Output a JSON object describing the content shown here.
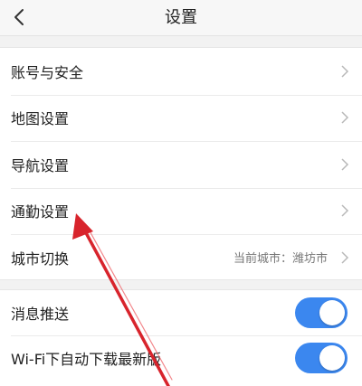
{
  "header": {
    "title": "设置"
  },
  "settings_group": [
    {
      "name": "settings-account-security",
      "label": "账号与安全"
    },
    {
      "name": "settings-map",
      "label": "地图设置"
    },
    {
      "name": "settings-navigation",
      "label": "导航设置"
    },
    {
      "name": "settings-commute",
      "label": "通勤设置"
    },
    {
      "name": "settings-city",
      "label": "城市切换",
      "value": "当前城市：潍坊市"
    }
  ],
  "toggles_group": [
    {
      "name": "message-push",
      "label": "消息推送",
      "on": true
    },
    {
      "name": "wifi-auto-download",
      "label": "Wi-Fi下自动下载最新版",
      "on": true
    }
  ],
  "colors": {
    "accent": "#3b87ef",
    "annotation_arrow": "#d8242c"
  }
}
